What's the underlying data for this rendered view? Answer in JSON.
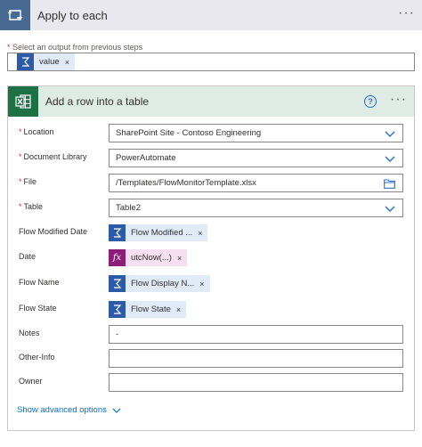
{
  "apply_to_each": {
    "title": "Apply to each",
    "more_label": "···",
    "select_label": "Select an output from previous steps",
    "selected_token": "value"
  },
  "action": {
    "title": "Add a row into a table",
    "help_label": "?",
    "more_label": "···",
    "fields": {
      "location": {
        "label": "Location",
        "value": "SharePoint Site - Contoso Engineering"
      },
      "document_library": {
        "label": "Document Library",
        "value": "PowerAutomate"
      },
      "file": {
        "label": "File",
        "value": "/Templates/FlowMonitorTemplate.xlsx"
      },
      "table": {
        "label": "Table",
        "value": "Table2"
      },
      "flow_modified_date": {
        "label": "Flow Modified Date",
        "token": "Flow Modified ..."
      },
      "date": {
        "label": "Date",
        "token": "utcNow(...)",
        "token_icon_text": "fx"
      },
      "flow_name": {
        "label": "Flow Name",
        "token": "Flow Display N..."
      },
      "flow_state": {
        "label": "Flow State",
        "token": "Flow State"
      },
      "notes": {
        "label": "Notes",
        "value": "-"
      },
      "other_info": {
        "label": "Other-Info",
        "value": ""
      },
      "owner": {
        "label": "Owner",
        "value": ""
      }
    },
    "advanced_options_label": "Show advanced options"
  },
  "token_remove_label": "×",
  "required_marker": "*",
  "icons": {
    "loop": "loop-icon",
    "excel": "excel-icon",
    "dynamic_content": "flow-dynamic-content-icon",
    "expression": "expression-fx-icon",
    "chevron": "chevron-down-icon",
    "folder": "folder-icon",
    "help": "help-icon"
  },
  "colors": {
    "loop_header_bg": "#e8e8ee",
    "loop_icon_bg": "#486991",
    "excel_green": "#1e7145",
    "excel_header_bg": "#dfece5",
    "token_blue_bg": "#e0ebf7",
    "token_blue_icon": "#2e5ba8",
    "token_purple_bg": "#f5dff0",
    "token_purple_icon": "#8d1d78",
    "link_blue": "#0f6cbd",
    "required_red": "#d13438"
  }
}
